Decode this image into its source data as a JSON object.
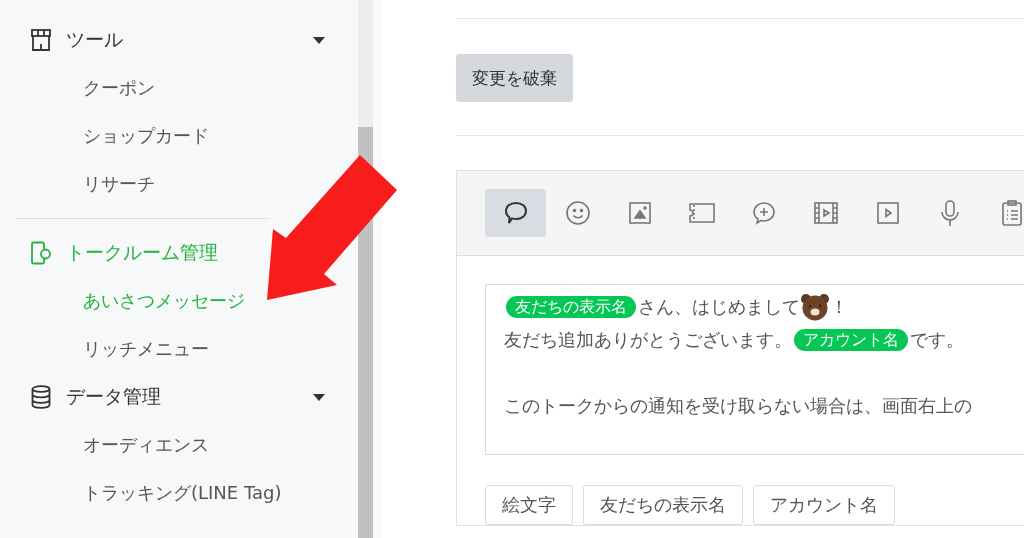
{
  "sidebar": {
    "groups": [
      {
        "label": "ツール",
        "collapsible": true,
        "selected": false,
        "children": [
          {
            "label": "クーポン",
            "selected": false
          },
          {
            "label": "ショップカード",
            "selected": false
          },
          {
            "label": "リサーチ",
            "selected": false
          }
        ]
      },
      {
        "label": "トークルーム管理",
        "collapsible": false,
        "selected": true,
        "children": [
          {
            "label": "あいさつメッセージ",
            "selected": true
          },
          {
            "label": "リッチメニュー",
            "selected": false
          }
        ]
      },
      {
        "label": "データ管理",
        "collapsible": true,
        "selected": false,
        "children": [
          {
            "label": "オーディエンス",
            "selected": false
          },
          {
            "label": "トラッキング(LINE Tag)",
            "selected": false
          }
        ]
      }
    ]
  },
  "discard_button": "変更を破棄",
  "toolbar": {
    "tools": [
      {
        "selected": true
      },
      {
        "selected": false
      },
      {
        "selected": false
      },
      {
        "selected": false
      },
      {
        "selected": false
      },
      {
        "selected": false
      },
      {
        "selected": false
      },
      {
        "selected": false
      },
      {
        "selected": false
      }
    ]
  },
  "message": {
    "lines": [
      [
        {
          "kind": "tag",
          "text": "友だちの表示名"
        },
        {
          "kind": "text",
          "text": "さん、はじめまして"
        },
        {
          "kind": "emoji"
        },
        {
          "kind": "text",
          "text": "！"
        }
      ],
      [
        {
          "kind": "text",
          "text": "友だち追加ありがとうございます。"
        },
        {
          "kind": "tag",
          "text": "アカウント名"
        },
        {
          "kind": "text",
          "text": "です。"
        }
      ],
      [
        {
          "kind": "text",
          "text": "このトークからの通知を受け取らない場合は、画面右上の"
        }
      ]
    ],
    "blank_line_before_last": true
  },
  "insert_buttons": [
    "絵文字",
    "友だちの表示名",
    "アカウント名"
  ]
}
